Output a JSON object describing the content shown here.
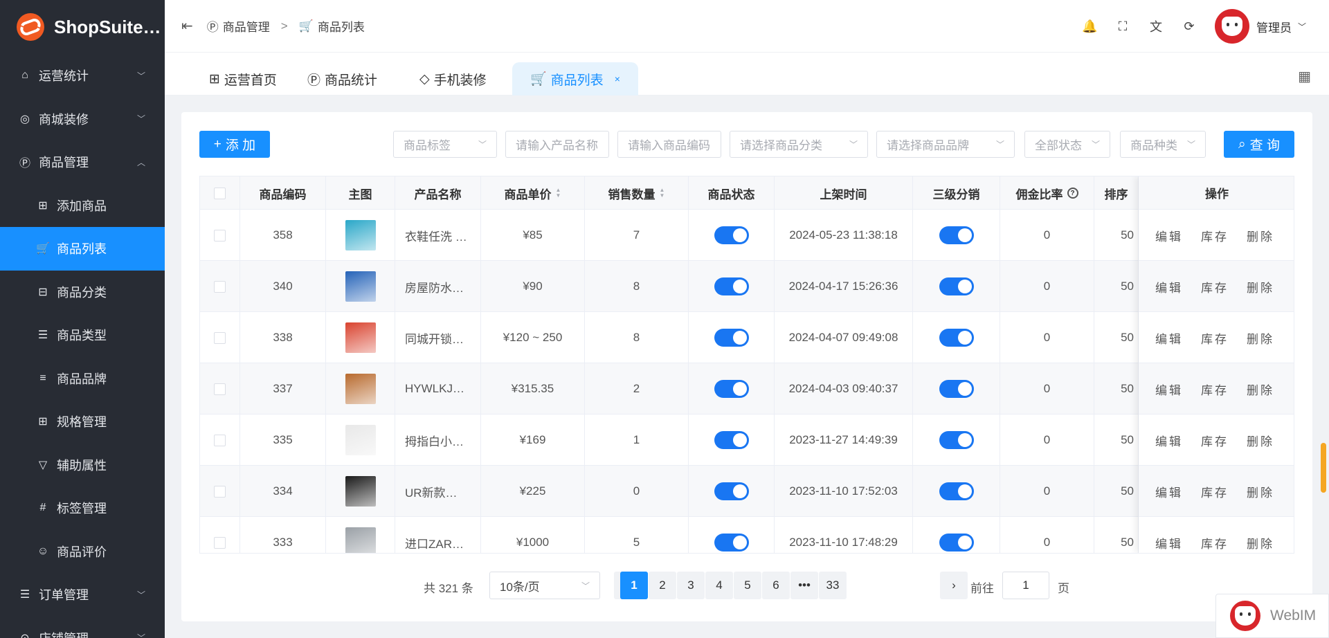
{
  "app": {
    "name": "ShopSuite…"
  },
  "sidebar": {
    "items": [
      {
        "label": "运营统计",
        "icon": "home-icon",
        "glyph": "⌂",
        "chevron": "﹀"
      },
      {
        "label": "商城装修",
        "icon": "palette-icon",
        "glyph": "◎",
        "chevron": "﹀"
      },
      {
        "label": "商品管理",
        "icon": "product-icon",
        "glyph": "Ⓟ",
        "chevron": "︿"
      },
      {
        "label": "添加商品",
        "icon": "plus-square-icon",
        "glyph": "⊞"
      },
      {
        "label": "商品列表",
        "icon": "basket-icon",
        "glyph": "🛒"
      },
      {
        "label": "商品分类",
        "icon": "category-icon",
        "glyph": "⊟"
      },
      {
        "label": "商品类型",
        "icon": "list-icon",
        "glyph": "☰"
      },
      {
        "label": "商品品牌",
        "icon": "menu-icon",
        "glyph": "≡"
      },
      {
        "label": "规格管理",
        "icon": "grid-icon",
        "glyph": "⊞"
      },
      {
        "label": "辅助属性",
        "icon": "filter-icon",
        "glyph": "▽"
      },
      {
        "label": "标签管理",
        "icon": "hash-icon",
        "glyph": "#"
      },
      {
        "label": "商品评价",
        "icon": "comment-icon",
        "glyph": "☺"
      },
      {
        "label": "订单管理",
        "icon": "order-icon",
        "glyph": "☰",
        "chevron": "﹀"
      },
      {
        "label": "店铺管理",
        "icon": "store-icon",
        "glyph": "⊙",
        "chevron": "﹀"
      }
    ]
  },
  "header": {
    "collapse_glyph": "⇤",
    "breadcrumb": [
      {
        "label": "商品管理",
        "glyph": "Ⓟ"
      },
      {
        "label": "商品列表",
        "glyph": "🛒"
      }
    ],
    "breadcrumb_sep": ">",
    "icons": {
      "bell": "🔔",
      "fullscreen": "⛶",
      "translate": "文",
      "refresh": "⟳"
    },
    "user": "管理员",
    "user_chev": "﹀"
  },
  "tabs": [
    {
      "label": "运营首页",
      "glyph": "⊞"
    },
    {
      "label": "商品统计",
      "glyph": "Ⓟ"
    },
    {
      "label": "手机装修",
      "glyph": "◇"
    },
    {
      "label": "商品列表",
      "glyph": "🛒",
      "close": "×"
    }
  ],
  "tabs_grid_glyph": "▦",
  "toolbar": {
    "add_label": "添 加",
    "add_glyph": "+",
    "query_label": "查 询",
    "query_glyph": "⌕",
    "filters": [
      {
        "placeholder": "商品标签",
        "chevron": "﹀"
      },
      {
        "placeholder": "请输入产品名称"
      },
      {
        "placeholder": "请输入商品编码"
      },
      {
        "placeholder": "请选择商品分类",
        "chevron": "﹀"
      },
      {
        "placeholder": "请选择商品品牌",
        "chevron": "﹀"
      },
      {
        "placeholder": "全部状态",
        "chevron": "﹀"
      },
      {
        "placeholder": "商品种类",
        "chevron": "﹀"
      }
    ]
  },
  "table": {
    "columns": [
      "商品编码",
      "主图",
      "产品名称",
      "商品单价",
      "销售数量",
      "商品状态",
      "上架时间",
      "三级分销",
      "佣金比率",
      "排序",
      "操作"
    ],
    "help_glyph": "?",
    "sort_glyph_up": "▲",
    "sort_glyph_down": "▼",
    "ops": {
      "edit": "编辑",
      "stock": "库存",
      "delete": "删除"
    },
    "rows": [
      {
        "code": "358",
        "name": "衣鞋任洗 …",
        "price": "¥85",
        "sales": "7",
        "status_on": true,
        "time": "2024-05-23 11:38:18",
        "dist_on": true,
        "rate": "0",
        "sort": "50",
        "thumb_color": "#2aa7c8"
      },
      {
        "code": "340",
        "name": "房屋防水…",
        "price": "¥90",
        "sales": "8",
        "status_on": true,
        "time": "2024-04-17 15:26:36",
        "dist_on": true,
        "rate": "0",
        "sort": "50",
        "thumb_color": "#2563b8"
      },
      {
        "code": "338",
        "name": "同城开锁…",
        "price": "¥120 ~ 250",
        "sales": "8",
        "status_on": true,
        "time": "2024-04-07 09:49:08",
        "dist_on": true,
        "rate": "0",
        "sort": "50",
        "thumb_color": "#d9432f"
      },
      {
        "code": "337",
        "name": "HYWLKJ…",
        "price": "¥315.35",
        "sales": "2",
        "status_on": true,
        "time": "2024-04-03 09:40:37",
        "dist_on": true,
        "rate": "0",
        "sort": "50",
        "thumb_color": "#b86a2e"
      },
      {
        "code": "335",
        "name": "拇指白小…",
        "price": "¥169",
        "sales": "1",
        "status_on": true,
        "time": "2023-11-27 14:49:39",
        "dist_on": true,
        "rate": "0",
        "sort": "50",
        "thumb_color": "#e8e8e8"
      },
      {
        "code": "334",
        "name": "UR新款…",
        "price": "¥225",
        "sales": "0",
        "status_on": true,
        "time": "2023-11-10 17:52:03",
        "dist_on": true,
        "rate": "0",
        "sort": "50",
        "thumb_color": "#1a1a1a"
      },
      {
        "code": "333",
        "name": "进口ZAR…",
        "price": "¥1000",
        "sales": "5",
        "status_on": true,
        "time": "2023-11-10 17:48:29",
        "dist_on": true,
        "rate": "0",
        "sort": "50",
        "thumb_color": "#9aa0a6"
      }
    ]
  },
  "pagination": {
    "total": "共 321 条",
    "page_size": "10条/页",
    "page_size_chev": "﹀",
    "prev": "‹",
    "next": "›",
    "pages": [
      "1",
      "2",
      "3",
      "4",
      "5",
      "6",
      "•••",
      "33"
    ],
    "current": "1",
    "goto_label": "前往",
    "goto_value": "1",
    "page_suffix": "页"
  },
  "webim": {
    "label": "WebIM"
  },
  "colors": {
    "primary": "#1890ff",
    "sidebar_bg": "#282c34",
    "switch_on": "#1976f2"
  }
}
